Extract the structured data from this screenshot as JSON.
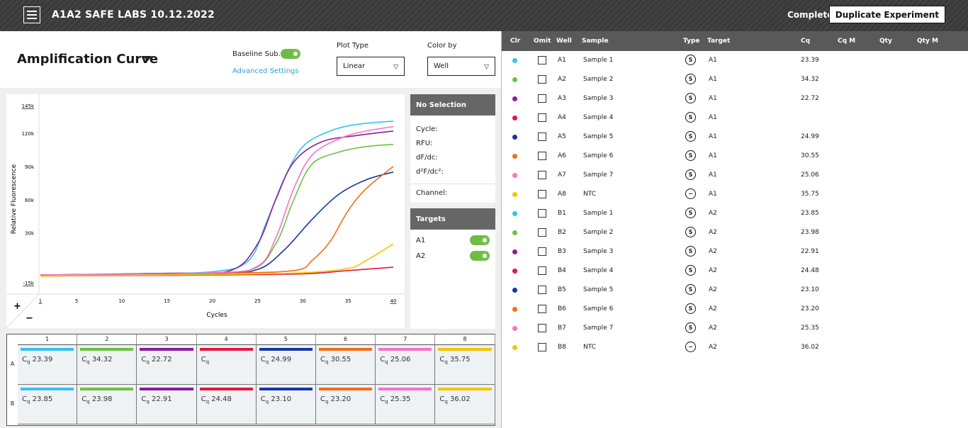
{
  "topbar": {
    "title": "A1A2 SAFE LABS 10.12.2022",
    "status": "Completed",
    "duplicate_label": "Duplicate Experiment"
  },
  "header": {
    "title": "Amplification Curve",
    "baseline_label": "Baseline Sub.",
    "baseline_on": true,
    "advanced_label": "Advanced Settings",
    "plot_type_label": "Plot Type",
    "plot_type_value": "Linear",
    "color_by_label": "Color by",
    "color_by_value": "Well"
  },
  "selection_panel": {
    "title": "No Selection",
    "fields": [
      "Cycle:",
      "RFU:",
      "dF/dc:",
      "d²F/dc²:"
    ],
    "channel_label": "Channel:"
  },
  "targets_panel": {
    "title": "Targets",
    "items": [
      {
        "label": "A1",
        "on": true
      },
      {
        "label": "A2",
        "on": true
      }
    ]
  },
  "zoom": {
    "plus": "+",
    "minus": "−"
  },
  "chart_data": {
    "type": "line",
    "xlabel": "Cycles",
    "ylabel": "Relative Fluorescence",
    "xlim": [
      1,
      40
    ],
    "ylim": [
      -15000,
      145000
    ],
    "x_ticks": [
      "1",
      "5",
      "10",
      "15",
      "20",
      "25",
      "30",
      "35",
      "40"
    ],
    "y_ticks": [
      "145k",
      "120k",
      "90k",
      "60k",
      "30k",
      "-15k"
    ],
    "series": [
      {
        "color": "#36c1ee",
        "points": [
          [
            1,
            -8000
          ],
          [
            10,
            -7000
          ],
          [
            20,
            -5000
          ],
          [
            24,
            5000
          ],
          [
            26,
            40000
          ],
          [
            28,
            80000
          ],
          [
            30,
            108000
          ],
          [
            33,
            122000
          ],
          [
            36,
            128000
          ],
          [
            40,
            131000
          ]
        ]
      },
      {
        "color": "#6dc142",
        "points": [
          [
            1,
            -8000
          ],
          [
            15,
            -6500
          ],
          [
            24,
            -4000
          ],
          [
            27,
            20000
          ],
          [
            29,
            60000
          ],
          [
            31,
            92000
          ],
          [
            34,
            103000
          ],
          [
            37,
            108000
          ],
          [
            40,
            110000
          ]
        ]
      },
      {
        "color": "#8a1d9b",
        "points": [
          [
            1,
            -8000
          ],
          [
            15,
            -6500
          ],
          [
            22,
            -4000
          ],
          [
            25,
            20000
          ],
          [
            27,
            60000
          ],
          [
            29,
            94000
          ],
          [
            32,
            112000
          ],
          [
            36,
            118000
          ],
          [
            40,
            122000
          ]
        ]
      },
      {
        "color": "#e4173e",
        "points": [
          [
            1,
            -9000
          ],
          [
            20,
            -8000
          ],
          [
            30,
            -7000
          ],
          [
            35,
            -4000
          ],
          [
            40,
            -1000
          ]
        ]
      },
      {
        "color": "#1336a8",
        "points": [
          [
            1,
            -8000
          ],
          [
            20,
            -6500
          ],
          [
            25,
            -3000
          ],
          [
            28,
            15000
          ],
          [
            31,
            42000
          ],
          [
            34,
            65000
          ],
          [
            37,
            78000
          ],
          [
            40,
            85000
          ]
        ]
      },
      {
        "color": "#f46d13",
        "points": [
          [
            1,
            -8000
          ],
          [
            20,
            -6500
          ],
          [
            29,
            -4000
          ],
          [
            31,
            5000
          ],
          [
            33,
            22000
          ],
          [
            35,
            50000
          ],
          [
            37,
            70000
          ],
          [
            40,
            90000
          ]
        ]
      },
      {
        "color": "#f772c8",
        "points": [
          [
            1,
            -8000
          ],
          [
            20,
            -6000
          ],
          [
            25,
            0
          ],
          [
            27,
            25000
          ],
          [
            29,
            70000
          ],
          [
            31,
            100000
          ],
          [
            34,
            115000
          ],
          [
            37,
            122000
          ],
          [
            40,
            126000
          ]
        ]
      },
      {
        "color": "#f5c400",
        "points": [
          [
            1,
            -9000
          ],
          [
            20,
            -7500
          ],
          [
            30,
            -6000
          ],
          [
            35,
            -2000
          ],
          [
            37,
            5000
          ],
          [
            40,
            20000
          ]
        ]
      }
    ]
  },
  "plate": {
    "columns": [
      "1",
      "2",
      "3",
      "4",
      "5",
      "6",
      "7",
      "8"
    ],
    "rows": [
      {
        "label": "A",
        "wells": [
          {
            "color": "#36c1ee",
            "cq": "23.39"
          },
          {
            "color": "#6dc142",
            "cq": "34.32"
          },
          {
            "color": "#8a1d9b",
            "cq": "22.72"
          },
          {
            "color": "#e4173e",
            "cq": ""
          },
          {
            "color": "#1336a8",
            "cq": "24.99"
          },
          {
            "color": "#f46d13",
            "cq": "30.55"
          },
          {
            "color": "#f772c8",
            "cq": "25.06"
          },
          {
            "color": "#f5c400",
            "cq": "35.75"
          }
        ]
      },
      {
        "label": "B",
        "wells": [
          {
            "color": "#36c1ee",
            "cq": "23.85"
          },
          {
            "color": "#6dc142",
            "cq": "23.98"
          },
          {
            "color": "#8a1d9b",
            "cq": "22.91"
          },
          {
            "color": "#e4173e",
            "cq": "24.48"
          },
          {
            "color": "#1336a8",
            "cq": "23.10"
          },
          {
            "color": "#f46d13",
            "cq": "23.20"
          },
          {
            "color": "#f772c8",
            "cq": "25.35"
          },
          {
            "color": "#f5c400",
            "cq": "36.02"
          }
        ]
      }
    ]
  },
  "table": {
    "headers": {
      "clr": "Clr",
      "omit": "Omit",
      "well": "Well",
      "sample": "Sample",
      "type": "Type",
      "target": "Target",
      "cq": "Cq",
      "cqm": "Cq M",
      "qty": "Qty",
      "qtym": "Qty M"
    },
    "rows": [
      {
        "color": "#36c1ee",
        "well": "A1",
        "sample": "Sample 1",
        "type": "S",
        "target": "A1",
        "cq": "23.39"
      },
      {
        "color": "#6dc142",
        "well": "A2",
        "sample": "Sample 2",
        "type": "S",
        "target": "A1",
        "cq": "34.32"
      },
      {
        "color": "#8a1d9b",
        "well": "A3",
        "sample": "Sample 3",
        "type": "S",
        "target": "A1",
        "cq": "22.72"
      },
      {
        "color": "#e4173e",
        "well": "A4",
        "sample": "Sample 4",
        "type": "S",
        "target": "A1",
        "cq": ""
      },
      {
        "color": "#1336a8",
        "well": "A5",
        "sample": "Sample 5",
        "type": "S",
        "target": "A1",
        "cq": "24.99"
      },
      {
        "color": "#f46d13",
        "well": "A6",
        "sample": "Sample 6",
        "type": "S",
        "target": "A1",
        "cq": "30.55"
      },
      {
        "color": "#f772c8",
        "well": "A7",
        "sample": "Sample 7",
        "type": "S",
        "target": "A1",
        "cq": "25.06"
      },
      {
        "color": "#f5c400",
        "well": "A8",
        "sample": "NTC",
        "type": "−",
        "target": "A1",
        "cq": "35.75"
      },
      {
        "color": "#36c1ee",
        "well": "B1",
        "sample": "Sample 1",
        "type": "S",
        "target": "A2",
        "cq": "23.85"
      },
      {
        "color": "#6dc142",
        "well": "B2",
        "sample": "Sample 2",
        "type": "S",
        "target": "A2",
        "cq": "23.98"
      },
      {
        "color": "#8a1d9b",
        "well": "B3",
        "sample": "Sample 3",
        "type": "S",
        "target": "A2",
        "cq": "22.91"
      },
      {
        "color": "#e4173e",
        "well": "B4",
        "sample": "Sample 4",
        "type": "S",
        "target": "A2",
        "cq": "24.48"
      },
      {
        "color": "#1336a8",
        "well": "B5",
        "sample": "Sample 5",
        "type": "S",
        "target": "A2",
        "cq": "23.10"
      },
      {
        "color": "#f46d13",
        "well": "B6",
        "sample": "Sample 6",
        "type": "S",
        "target": "A2",
        "cq": "23.20"
      },
      {
        "color": "#f772c8",
        "well": "B7",
        "sample": "Sample 7",
        "type": "S",
        "target": "A2",
        "cq": "25.35"
      },
      {
        "color": "#f5c400",
        "well": "B8",
        "sample": "NTC",
        "type": "−",
        "target": "A2",
        "cq": "36.02"
      }
    ]
  }
}
